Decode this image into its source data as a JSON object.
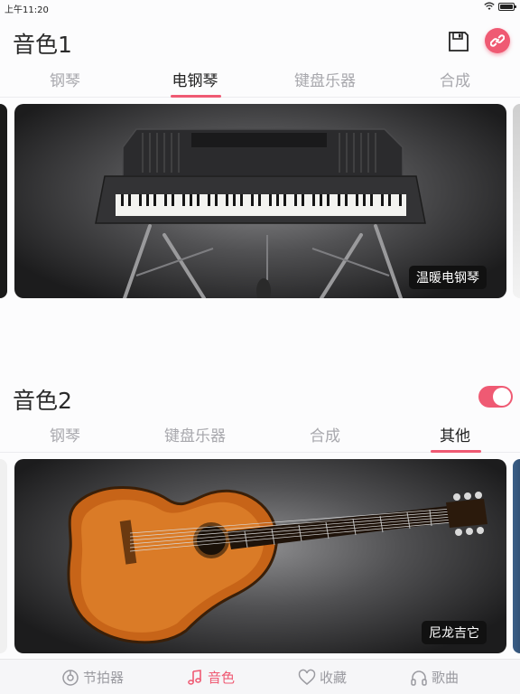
{
  "status": {
    "time": "上午11:20"
  },
  "section1": {
    "title": "音色1",
    "tabs": [
      "钢琴",
      "电钢琴",
      "键盘乐器",
      "合成"
    ],
    "active_tab": 1,
    "card_label": "温暖电钢琴"
  },
  "section2": {
    "title": "音色2",
    "toggle_on": true,
    "tabs": [
      "钢琴",
      "键盘乐器",
      "合成",
      "其他"
    ],
    "active_tab": 3,
    "card_label": "尼龙吉它"
  },
  "bottom_nav": [
    {
      "label": "节拍器",
      "icon": "metronome-icon"
    },
    {
      "label": "音色",
      "icon": "music-note-icon"
    },
    {
      "label": "收藏",
      "icon": "heart-icon"
    },
    {
      "label": "歌曲",
      "icon": "headphones-icon"
    }
  ],
  "bottom_active": 1,
  "colors": {
    "accent": "#ef5a73",
    "inactive": "#a8a8ad"
  }
}
